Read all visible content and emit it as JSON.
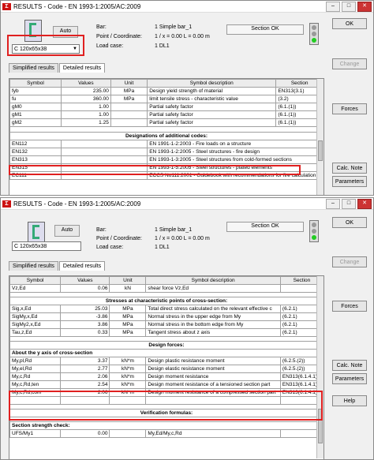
{
  "top": {
    "title": "RESULTS - Code - EN 1993-1:2005/AC:2009",
    "auto_label": "Auto",
    "section": "C 120x65x38",
    "bar_label": "Bar:",
    "bar_value": "1  Simple bar_1",
    "point_label": "Point / Coordinate:",
    "point_value": "1 / x = 0.00 L = 0.00 m",
    "load_label": "Load case:",
    "load_value": "1  DL1",
    "status": "Section OK",
    "buttons": {
      "ok": "OK",
      "change": "Change",
      "forces": "Forces",
      "calc": "Calc. Note",
      "params": "Parameters"
    },
    "tabs": [
      "Simplified results",
      "Detailed results"
    ],
    "columns": [
      "Symbol",
      "Values",
      "Unit",
      "Symbol description",
      "Section"
    ],
    "rows": [
      [
        "fyb",
        "235.00",
        "MPa",
        "Design yield strength of material",
        "EN313(3.1)"
      ],
      [
        "fu",
        "360.00",
        "MPa",
        "limit tensile stress - characteristic value",
        "(3.2)"
      ],
      [
        "gM0",
        "1.00",
        "",
        "Partial safety factor",
        "(6.1.(1))"
      ],
      [
        "gM1",
        "1.00",
        "",
        "Partial safety factor",
        "(6.1.(1))"
      ],
      [
        "gM2",
        "1.25",
        "",
        "Partial safety factor",
        "(6.1.(1))"
      ]
    ],
    "section_header": "Designations of additional codes:",
    "code_rows": [
      [
        "EN112",
        "EN 1991-1-2:2003 - Fire loads on a structure"
      ],
      [
        "EN132",
        "EN 1993-1-2:2005 - Steel structures - fire design"
      ],
      [
        "EN313",
        "EN 1993-1-3:2005 - Steel structures from cold-formed sections"
      ],
      [
        "EN315",
        "EN 1993-1-5:2005 - Steel structures - plated elements"
      ],
      [
        "EC111",
        "ECCS No111:2001 - Guidebook with recommendations for fire calculation"
      ]
    ]
  },
  "bottom": {
    "title": "RESULTS - Code - EN 1993-1:2005/AC:2009",
    "auto_label": "Auto",
    "section": "C 120x65x38",
    "bar_label": "Bar:",
    "bar_value": "1  Simple bar_1",
    "point_label": "Point / Coordinate:",
    "point_value": "1 / x = 0.00 L = 0.00 m",
    "load_label": "Load case:",
    "load_value": "1  DL1",
    "status": "Section OK",
    "buttons": {
      "ok": "OK",
      "change": "Change",
      "forces": "Forces",
      "calc": "Calc. Note",
      "params": "Parameters",
      "help": "Help"
    },
    "tabs": [
      "Simplified results",
      "Detailed results"
    ],
    "columns": [
      "Symbol",
      "Values",
      "Unit",
      "Symbol description",
      "Section"
    ],
    "row0": [
      "Vz,Ed",
      "0.06",
      "kN",
      "shear force Vz,Ed",
      ""
    ],
    "header1": "Stresses at characteristic points of cross-section:",
    "rows1": [
      [
        "Sig,x,Ed",
        "25.03",
        "MPa",
        "Total direct stress calculated on the relevant effective c",
        "(6.2.1)"
      ],
      [
        "SigMy,x,Ed",
        "-3.86",
        "MPa",
        "Normal stress in the upper edge from My",
        "(6.2.1)"
      ],
      [
        "SigMy2,x,Ed",
        "3.86",
        "MPa",
        "Normal stress in the bottom edge from My",
        "(6.2.1)"
      ],
      [
        "Tau,z,Ed",
        "0.33",
        "MPa",
        "Tangent stress about z axis",
        "(6.2.1)"
      ]
    ],
    "header2": "Design forces:",
    "header3": "About the y axis of cross-section",
    "rows2": [
      [
        "My,pl,Rd",
        "3.37",
        "kN*m",
        "Design plastic resistance moment",
        "(6.2.5.(2))"
      ],
      [
        "My,el,Rd",
        "2.77",
        "kN*m",
        "Design elastic resistance moment",
        "(6.2.5.(2))"
      ],
      [
        "My,c,Rd",
        "2.06",
        "kN*m",
        "Design moment resistance",
        "EN313(6.1.4.1)"
      ],
      [
        "My,c,Rd,ten",
        "2.54",
        "kN*m",
        "Design moment resistance of a tensioned section part",
        "EN313(6.1.4.1)"
      ],
      [
        "My,c,Rd,com",
        "2.06",
        "kN*m",
        "Design moment resistance of a compressed section part",
        "EN313(6.1.4.1)"
      ],
      [
        "",
        "",
        "",
        "",
        ""
      ]
    ],
    "header4": "Verification formulas:",
    "header5": "Section strength check:",
    "last_row": [
      "UFS/My1",
      "0.00",
      "",
      "My,Ed/My,c,Rd",
      ""
    ]
  }
}
